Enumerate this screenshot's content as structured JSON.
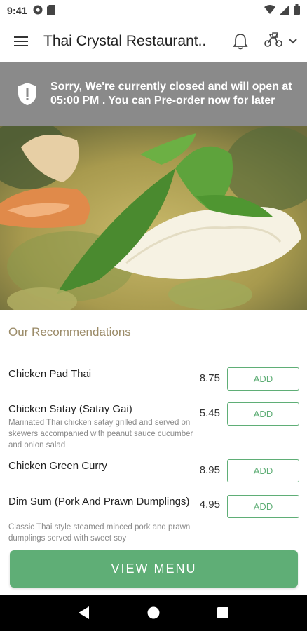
{
  "status_bar": {
    "time": "9:41"
  },
  "app_bar": {
    "title": "Thai Crystal Restaurant.."
  },
  "banner": {
    "message": "Sorry, We're currently closed and will open at 05:00 PM . You can Pre-order now for later"
  },
  "section": {
    "title": "Our Recommendations"
  },
  "items": [
    {
      "name": "Chicken Pad Thai",
      "description": "",
      "price": "8.75",
      "add_label": "ADD"
    },
    {
      "name": "Chicken Satay (Satay Gai)",
      "description": "Marinated Thai chicken satay grilled and served on skewers accompanied with peanut sauce cucumber and onion salad",
      "price": "5.45",
      "add_label": "ADD"
    },
    {
      "name": "Chicken Green Curry",
      "description": "",
      "price": "8.95",
      "add_label": "ADD"
    },
    {
      "name": "Dim Sum (Pork And Prawn Dumplings)",
      "description": "Classic Thai style steamed minced pork and prawn dumplings served with sweet soy",
      "price": "4.95",
      "add_label": "ADD"
    }
  ],
  "cta": {
    "label": "VIEW MENU"
  },
  "colors": {
    "accent": "#5fae76",
    "banner": "#8a8a8a",
    "section_title": "#9a8a67"
  }
}
